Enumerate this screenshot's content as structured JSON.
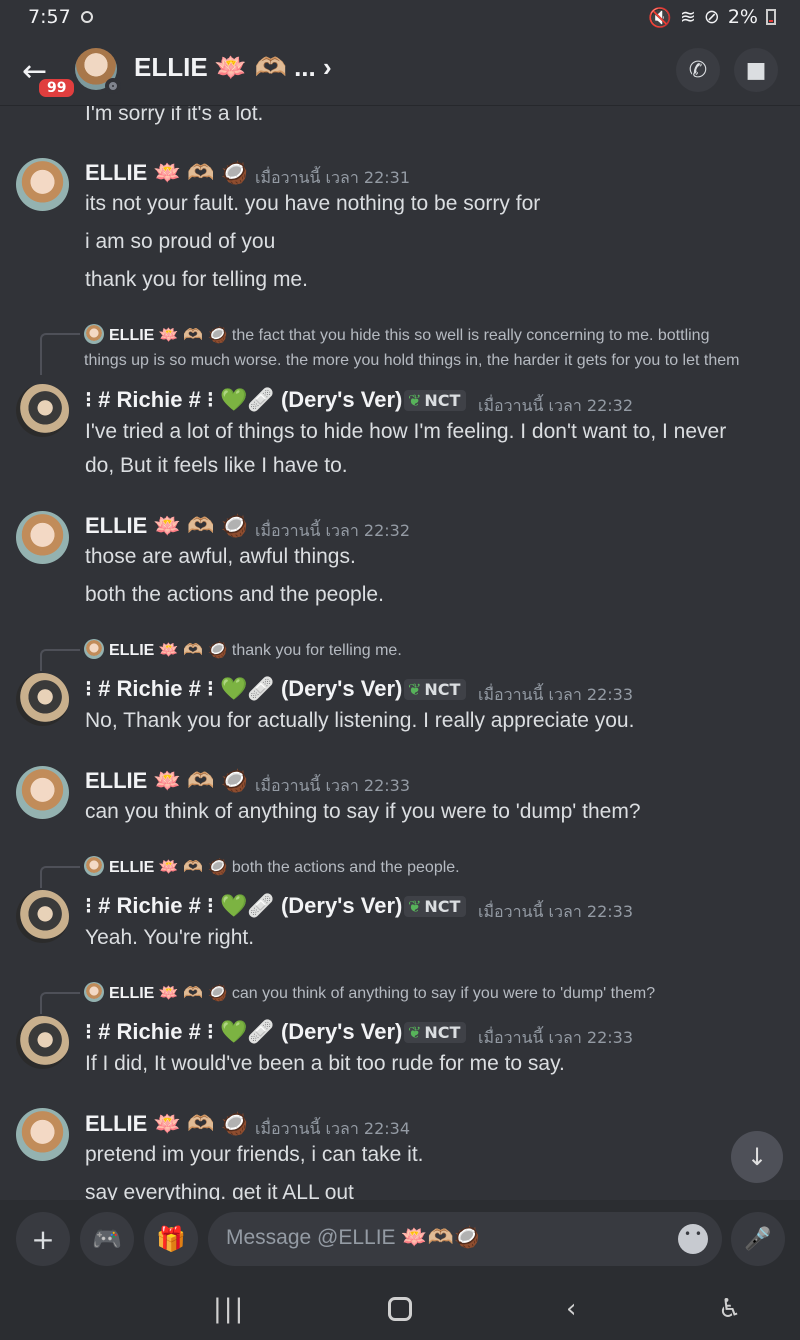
{
  "status": {
    "time": "7:57",
    "battery": "2%"
  },
  "header": {
    "badge": "99",
    "title": "ELLIE 🪷 🫶🏼 ... ›"
  },
  "chat": {
    "partial_top": "I'm sorry if it's a lot.",
    "messages": [
      {
        "author": "ELLIE 🪷 🫶🏼 🥥",
        "time": "เมื่อวานนี้ เวลา 22:31",
        "lines": [
          "its not your fault. you have nothing to be sorry for",
          "i am so proud of you",
          "thank you for telling me."
        ]
      },
      {
        "reply_name": "ELLIE 🪷 🫶🏼 🥥",
        "reply_text1": "the fact that you hide this so well is really concerning to me. bottling",
        "reply_text2": "things up is so much worse. the more you hold things in, the harder it gets for you to let them",
        "author": "⁝ # Richie # ⁝ 💚🩹 (Dery's Ver)",
        "tag": "NCT",
        "time": "เมื่อวานนี้ เวลา 22:32",
        "lines": [
          "I've tried a lot of things to hide how I'm feeling. I don't want to, I never",
          "do, But it feels like I have to."
        ]
      },
      {
        "author": "ELLIE 🪷 🫶🏼 🥥",
        "time": "เมื่อวานนี้ เวลา 22:32",
        "lines": [
          "those are awful, awful things.",
          "both the actions and the people."
        ]
      },
      {
        "reply_name": "ELLIE 🪷 🫶🏼 🥥",
        "reply_text1": "thank you for telling me.",
        "author": "⁝ # Richie # ⁝ 💚🩹 (Dery's Ver)",
        "tag": "NCT",
        "time": "เมื่อวานนี้ เวลา 22:33",
        "lines": [
          "No, Thank you for actually listening. I really appreciate you."
        ]
      },
      {
        "author": "ELLIE 🪷 🫶🏼 🥥",
        "time": "เมื่อวานนี้ เวลา 22:33",
        "lines": [
          "can you think of anything to say if you were to 'dump' them?"
        ]
      },
      {
        "reply_name": "ELLIE 🪷 🫶🏼 🥥",
        "reply_text1": "both the actions and the people.",
        "author": "⁝ # Richie # ⁝ 💚🩹 (Dery's Ver)",
        "tag": "NCT",
        "time": "เมื่อวานนี้ เวลา 22:33",
        "lines": [
          "Yeah. You're right."
        ]
      },
      {
        "reply_name": "ELLIE 🪷 🫶🏼 🥥",
        "reply_text1": "can you think of anything to say if you were to 'dump' them?",
        "author": "⁝ # Richie # ⁝ 💚🩹 (Dery's Ver)",
        "tag": "NCT",
        "time": "เมื่อวานนี้ เวลา 22:33",
        "lines": [
          "If I did, It would've been a bit too rude for me to say."
        ]
      },
      {
        "author": "ELLIE 🪷 🫶🏼 🥥",
        "time": "เมื่อวานนี้ เวลา 22:34",
        "lines": [
          "pretend im your friends, i can take it.",
          "say everything. get it ALL out"
        ]
      }
    ]
  },
  "composer": {
    "placeholder": "Message @ELLIE 🪷🫶🏼🥥"
  },
  "colors": {
    "background": "#313338",
    "composer_bg": "#2b2d31",
    "badge": "#e03e3e"
  }
}
